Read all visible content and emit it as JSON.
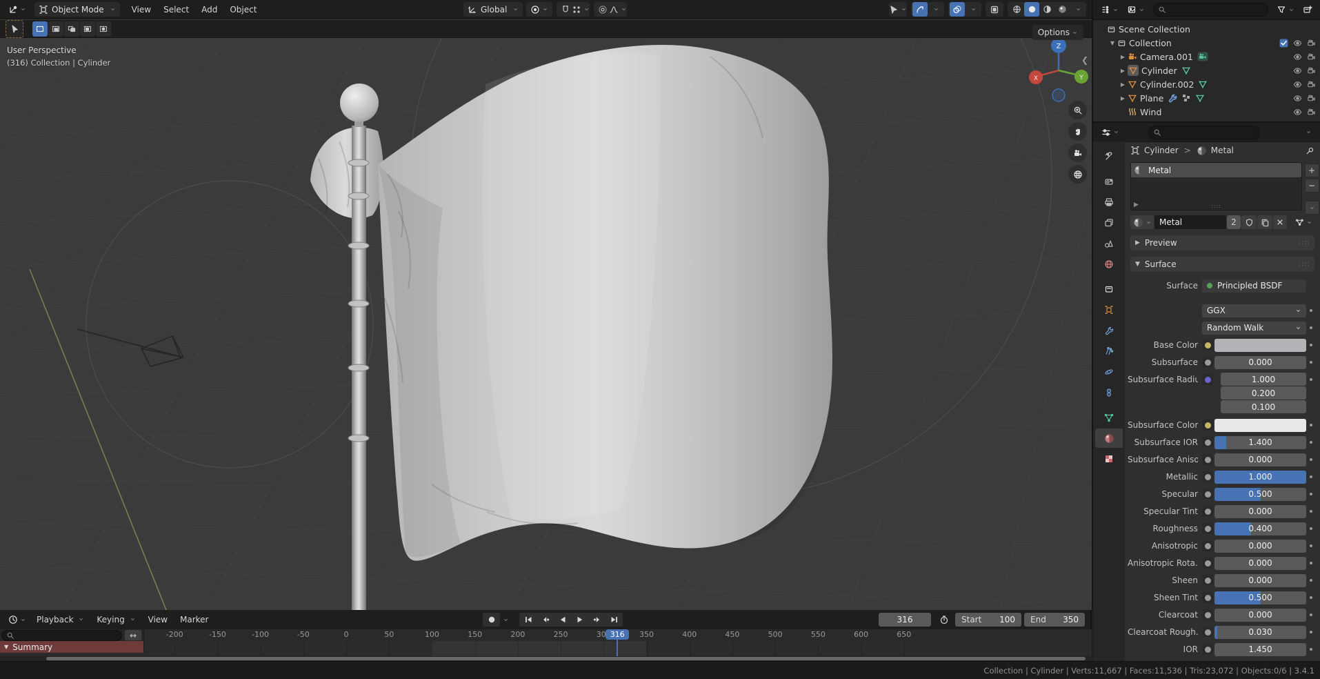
{
  "viewport": {
    "header": {
      "mode": "Object Mode",
      "menus": [
        "View",
        "Select",
        "Add",
        "Object"
      ],
      "orientation": "Global",
      "options": "Options"
    },
    "overlay": {
      "line1": "User Perspective",
      "line2": "(316) Collection | Cylinder"
    },
    "gizmo": {
      "top": "Z",
      "left": "X",
      "right": "Y"
    }
  },
  "outliner": {
    "rows": [
      {
        "label": "Scene Collection",
        "icon": "collection",
        "indent": 0,
        "disclosure": "",
        "badges": [],
        "right": []
      },
      {
        "label": "Collection",
        "icon": "collection",
        "indent": 1,
        "disclosure": "down",
        "badges": [],
        "right": [
          "checkbox",
          "eye",
          "camera-restrict"
        ]
      },
      {
        "label": "Camera.001",
        "icon": "camera-object",
        "indent": 2,
        "disclosure": "right",
        "badges": [
          "camera-data"
        ],
        "right": [
          "eye",
          "camera-restrict"
        ]
      },
      {
        "label": "Cylinder",
        "icon": "mesh-object",
        "indent": 2,
        "disclosure": "right",
        "badges": [
          "mesh-data"
        ],
        "right": [
          "eye",
          "camera-restrict"
        ],
        "active": true
      },
      {
        "label": "Cylinder.002",
        "icon": "mesh-object",
        "indent": 2,
        "disclosure": "right",
        "badges": [
          "mesh-data"
        ],
        "right": [
          "eye",
          "camera-restrict"
        ]
      },
      {
        "label": "Plane",
        "icon": "mesh-object",
        "indent": 2,
        "disclosure": "right",
        "badges": [
          "modifier",
          "nodes",
          "mesh-data"
        ],
        "right": [
          "eye",
          "camera-restrict"
        ]
      },
      {
        "label": "Wind",
        "icon": "wind",
        "indent": 2,
        "disclosure": "",
        "badges": [],
        "right": [
          "eye",
          "camera-restrict"
        ]
      }
    ]
  },
  "properties": {
    "breadcrumb": {
      "object": "Cylinder",
      "separator": ">",
      "material": "Metal"
    },
    "tabs": {
      "list": [
        "tool",
        "render",
        "output",
        "view-layer",
        "scene",
        "world",
        "collection",
        "object",
        "modifiers",
        "particles",
        "physics",
        "constraints",
        "object-data",
        "material",
        "texture"
      ],
      "active": "material"
    },
    "slot": {
      "name": "Metal"
    },
    "id_block": {
      "name": "Metal",
      "users": "2"
    },
    "panels": {
      "preview": "Preview",
      "surface": "Surface"
    },
    "surface_row": {
      "label": "Surface",
      "value": "Principled BSDF"
    },
    "rows": [
      {
        "type": "dropdown",
        "label": "",
        "value": "GGX"
      },
      {
        "type": "dropdown",
        "label": "",
        "value": "Random Walk"
      },
      {
        "type": "color",
        "label": "Base Color",
        "socket": "#c8b465",
        "value": "#b4b4b8"
      },
      {
        "type": "slider",
        "label": "Subsurface",
        "socket": "#9a9a9a",
        "value": "0.000",
        "fill": 0
      },
      {
        "type": "vector",
        "label": "Subsurface Radius",
        "socket": "#6b66cf",
        "values": [
          "1.000",
          "0.200",
          "0.100"
        ]
      },
      {
        "type": "color",
        "label": "Subsurface Color",
        "socket": "#c8b465",
        "value": "#e8e8e8"
      },
      {
        "type": "slider",
        "label": "Subsurface IOR",
        "socket": "#9a9a9a",
        "value": "1.400",
        "fill": 0.13
      },
      {
        "type": "slider",
        "label": "Subsurface Aniso...",
        "socket": "#9a9a9a",
        "value": "0.000",
        "fill": 0
      },
      {
        "type": "slider",
        "label": "Metallic",
        "socket": "#9a9a9a",
        "value": "1.000",
        "fill": 1
      },
      {
        "type": "slider",
        "label": "Specular",
        "socket": "#9a9a9a",
        "value": "0.500",
        "fill": 0.5
      },
      {
        "type": "slider",
        "label": "Specular Tint",
        "socket": "#9a9a9a",
        "value": "0.000",
        "fill": 0
      },
      {
        "type": "slider",
        "label": "Roughness",
        "socket": "#9a9a9a",
        "value": "0.400",
        "fill": 0.4
      },
      {
        "type": "slider",
        "label": "Anisotropic",
        "socket": "#9a9a9a",
        "value": "0.000",
        "fill": 0
      },
      {
        "type": "slider",
        "label": "Anisotropic Rota...",
        "socket": "#9a9a9a",
        "value": "0.000",
        "fill": 0
      },
      {
        "type": "slider",
        "label": "Sheen",
        "socket": "#9a9a9a",
        "value": "0.000",
        "fill": 0
      },
      {
        "type": "slider",
        "label": "Sheen Tint",
        "socket": "#9a9a9a",
        "value": "0.500",
        "fill": 0.5
      },
      {
        "type": "slider",
        "label": "Clearcoat",
        "socket": "#9a9a9a",
        "value": "0.000",
        "fill": 0
      },
      {
        "type": "slider",
        "label": "Clearcoat Rough...",
        "socket": "#9a9a9a",
        "value": "0.030",
        "fill": 0.03
      },
      {
        "type": "number",
        "label": "IOR",
        "socket": "#9a9a9a",
        "value": "1.450",
        "fill": 0
      }
    ]
  },
  "timeline": {
    "menus": [
      "Playback",
      "Keying",
      "View",
      "Marker"
    ],
    "summary": "Summary",
    "current_frame": "316",
    "start_label": "Start",
    "start_value": "100",
    "end_label": "End",
    "end_value": "350",
    "ruler_frames": [
      -200,
      -150,
      -100,
      -50,
      0,
      50,
      100,
      150,
      200,
      250,
      300,
      350,
      400,
      450,
      500,
      550,
      600,
      650
    ],
    "playhead_frame": 316,
    "frame_range": {
      "start": 100,
      "end": 350
    }
  },
  "status_bar": {
    "right": "Collection | Cylinder | Verts:11,667 | Faces:11,536 | Tris:23,072 | Objects:0/6 | 3.4.1"
  },
  "colors": {
    "accent": "#4772b3",
    "summary_channel": "#6e3b3a",
    "mesh_orange": "#d98d3e",
    "data_green": "#56c498",
    "modifier_blue": "#6f9fd8"
  }
}
